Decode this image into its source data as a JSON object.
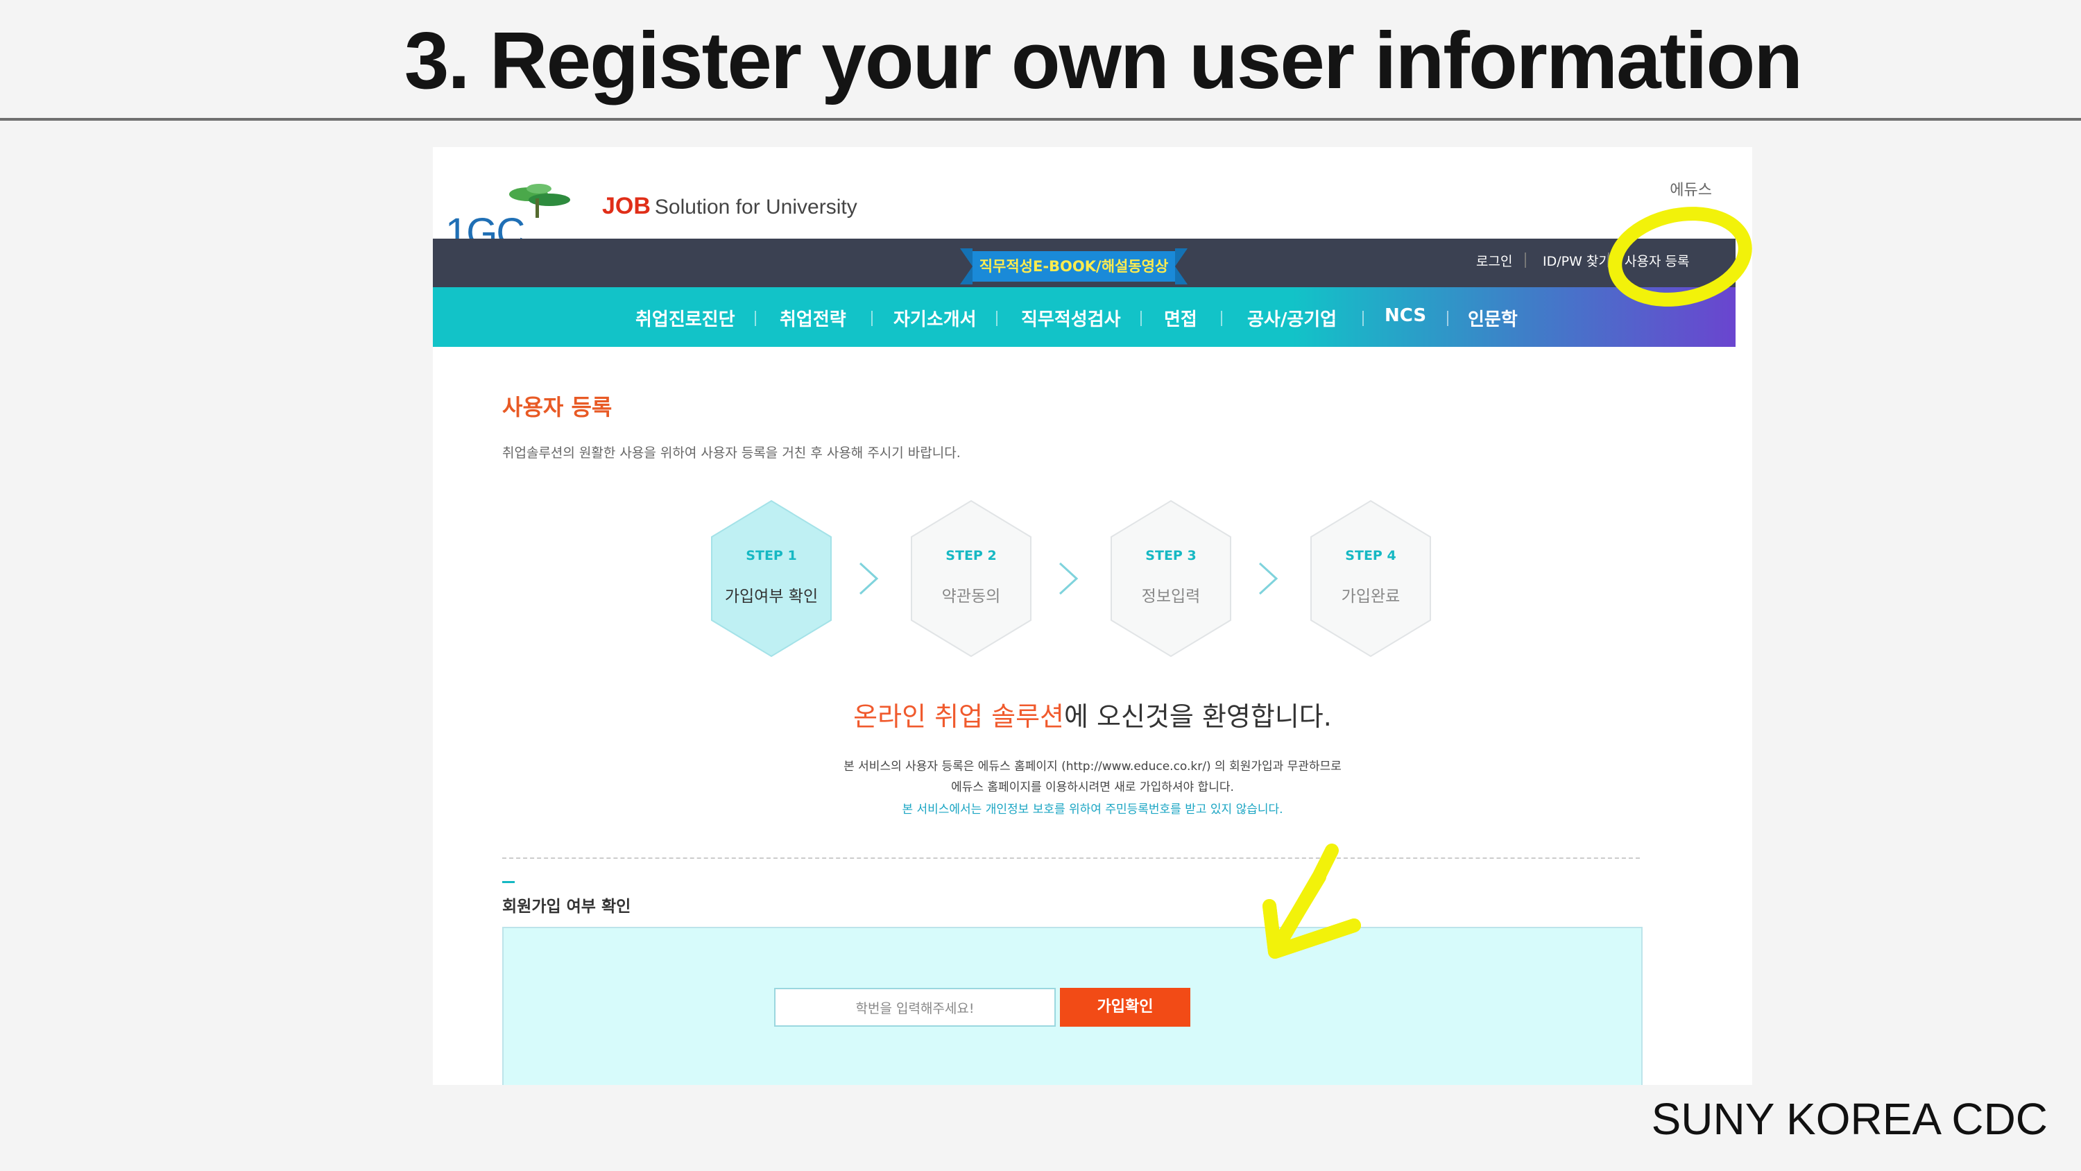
{
  "slide": {
    "title": "3. Register your own user information",
    "footer": "SUNY KOREA CDC"
  },
  "site": {
    "logo_text": "1GC",
    "brand_job": "JOB",
    "brand_rest": "Solution for University",
    "top_link": "에듀스",
    "banner": "직무적성E-BOOK/해설동영상",
    "util_links": [
      "로그인",
      "ID/PW 찾기",
      "사용자 등록"
    ],
    "nav": [
      "취업진로진단",
      "취업전략",
      "자기소개서",
      "직무적성검사",
      "면접",
      "공사/공기업",
      "NCS",
      "인문학"
    ]
  },
  "page": {
    "title": "사용자 등록",
    "desc": "취업솔루션의 원활한 사용을 위하여 사용자 등록을 거친 후 사용해 주시기 바랍니다.",
    "steps": [
      {
        "num": "STEP 1",
        "label": "가입여부 확인"
      },
      {
        "num": "STEP 2",
        "label": "약관동의"
      },
      {
        "num": "STEP 3",
        "label": "정보입력"
      },
      {
        "num": "STEP 4",
        "label": "가입완료"
      }
    ],
    "welcome_accent": "온라인 취업 솔루션",
    "welcome_rest": "에 오신것을 환영합니다.",
    "note1": "본 서비스의 사용자 등록은 에듀스 홈페이지 (http://www.educe.co.kr/) 의 회원가입과 무관하므로",
    "note2": "에듀스 홈페이지를 이용하시려면 새로 가입하셔야 합니다.",
    "note3": "본 서비스에서는 개인정보 보호를 위하여 주민등록번호를 받고 있지 않습니다.",
    "section_title": "회원가입 여부 확인",
    "input_placeholder": "학번을 입력해주세요!",
    "confirm_button": "가입확인"
  },
  "colors": {
    "accent_teal": "#12c3c8",
    "accent_orange": "#f24b16",
    "highlight_yellow": "#f2f20a",
    "topbar": "#3b4152"
  }
}
